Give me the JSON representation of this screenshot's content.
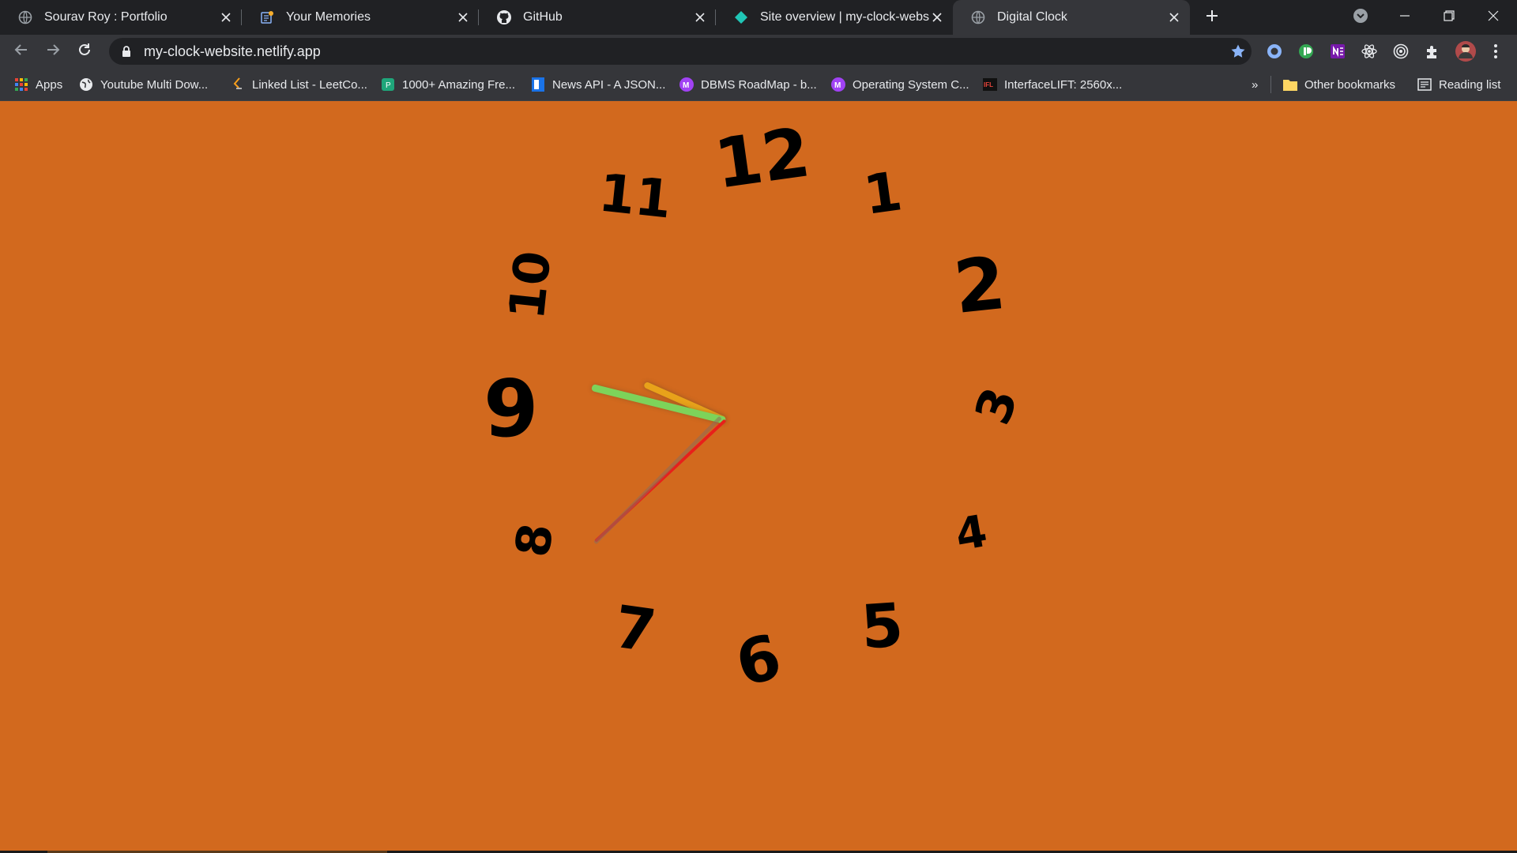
{
  "tabs": [
    {
      "title": "Sourav Roy : Portfolio",
      "icon": "globe-icon"
    },
    {
      "title": "Your Memories",
      "icon": "memories-icon"
    },
    {
      "title": "GitHub",
      "icon": "github-icon"
    },
    {
      "title": "Site overview | my-clock-website",
      "icon": "netlify-icon"
    },
    {
      "title": "Digital Clock",
      "icon": "globe-icon",
      "active": true
    }
  ],
  "toolbar": {
    "url": "my-clock-website.netlify.app"
  },
  "bookmarks": {
    "items": [
      {
        "label": "Apps",
        "icon": "apps-grid-icon"
      },
      {
        "label": "Youtube Multi Dow...",
        "icon": "globe-icon"
      },
      {
        "label": "Linked List - LeetCo...",
        "icon": "leetcode-icon"
      },
      {
        "label": "1000+ Amazing Fre...",
        "icon": "freepik-icon"
      },
      {
        "label": "News API - A JSON...",
        "icon": "newsapi-icon"
      },
      {
        "label": "DBMS RoadMap - b...",
        "icon": "m-icon"
      },
      {
        "label": "Operating System C...",
        "icon": "m-icon"
      },
      {
        "label": "InterfaceLIFT: 2560x...",
        "icon": "ifl-icon"
      }
    ],
    "overflow": "»",
    "other": "Other bookmarks",
    "reading_list": "Reading list"
  },
  "clock": {
    "numerals": [
      "12",
      "1",
      "2",
      "3",
      "4",
      "5",
      "6",
      "7",
      "8",
      "9",
      "10",
      "11"
    ],
    "background_color": "#d2691e",
    "hand_colors": {
      "hour": "#e8a21a",
      "minute": "#7dd35a",
      "second": "#e8201a"
    }
  },
  "colors": {
    "tabstrip": "#202124",
    "toolbar": "#35363a",
    "accent_star": "#8ab4f8"
  }
}
